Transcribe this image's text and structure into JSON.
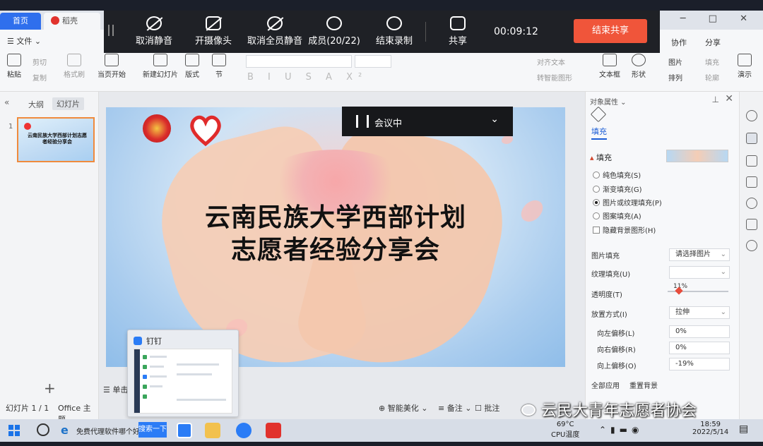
{
  "tabs": {
    "home": "首页",
    "app": "稻壳"
  },
  "ribbon": {
    "file_menu": "文件",
    "paste": "粘贴",
    "cut": "剪切",
    "copy": "复制",
    "format_painter": "格式刷",
    "from_current": "当页开始",
    "new_slide": "新建幻灯片",
    "layout": "版式",
    "section": "节",
    "align_text": "对齐文本",
    "smart_art": "转智能图形",
    "text_box": "文本框",
    "shapes": "形状",
    "arrange": "排列",
    "picture": "图片",
    "fill": "填充",
    "outline": "轮廓",
    "present": "演示",
    "collab": "协作",
    "share": "分享"
  },
  "meeting_bar": {
    "unmute": "取消静音",
    "camera": "开摄像头",
    "unmute_all": "取消全员静音",
    "members": "成员(20/22)",
    "end_record": "结束录制",
    "share": "共享",
    "timer": "00:09:12",
    "end_share": "结束共享"
  },
  "meeting_pill": {
    "label": "会议中"
  },
  "left_panel": {
    "tab_outline": "大纲",
    "tab_slides": "幻灯片",
    "slide_number": "1",
    "slide_status": "幻灯片 1 / 1",
    "theme": "Office 主题"
  },
  "slide": {
    "title_line1": "云南民族大学西部计划",
    "title_line2": "志愿者经验分享会",
    "thumb_title": "云南民族大学西部计划志愿者经验分享会"
  },
  "bottom_bar": {
    "notes": "单击",
    "beautify": "智能美化",
    "notes_btn": "备注",
    "comments": "批注"
  },
  "popup": {
    "title": "钉钉"
  },
  "right_panel": {
    "title": "对象属性",
    "fill_tab": "填充",
    "section": "填充",
    "options": [
      {
        "label": "纯色填充(S)",
        "selected": false
      },
      {
        "label": "渐变填充(G)",
        "selected": false
      },
      {
        "label": "图片或纹理填充(P)",
        "selected": true
      },
      {
        "label": "图案填充(A)",
        "selected": false
      }
    ],
    "hide_bg": "隐藏背景图形(H)",
    "picture_fill_label": "图片填充",
    "picture_fill_value": "请选择图片",
    "texture_fill_label": "纹理填充(U)",
    "transparency_label": "透明度(T)",
    "transparency_value": "11%",
    "placement_label": "放置方式(I)",
    "placement_value": "拉伸",
    "offset_left_label": "向左偏移(L)",
    "offset_left_value": "0%",
    "offset_right_label": "向右偏移(R)",
    "offset_right_value": "0%",
    "offset_up_label": "向上偏移(O)",
    "offset_up_value": "-19%",
    "apply_all": "全部应用",
    "reset_bg": "重置背景"
  },
  "watermark": "云民大青年志愿者协会",
  "taskbar": {
    "promo": "免费代理软件哪个好",
    "search_btn": "搜索一下",
    "temp": "69°C",
    "cpu": "CPU温度",
    "time": "18:59",
    "date": "2022/5/14"
  },
  "colors": {
    "accent": "#2f6fed",
    "end_share": "#f0553a",
    "meeting_bar": "#1f2126",
    "thumb_border": "#f08a3c"
  }
}
